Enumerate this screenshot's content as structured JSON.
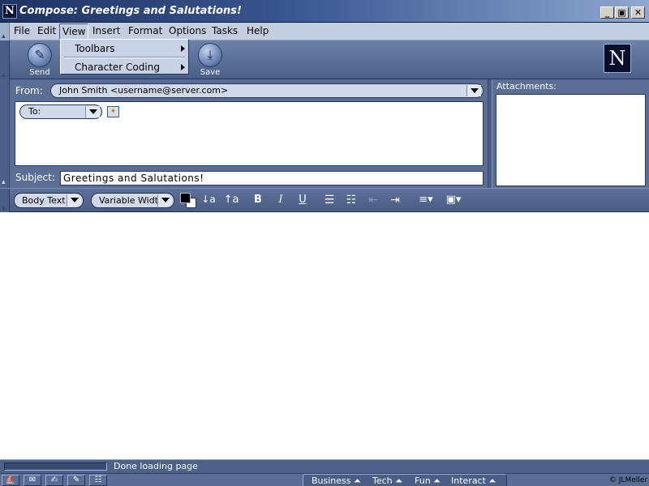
{
  "window": {
    "title": "Compose: Greetings and Salutations!",
    "app_icon": "N",
    "minimize_glyph": "_",
    "maximize_glyph": "▣",
    "close_glyph": "✕"
  },
  "menubar": {
    "items": [
      "File",
      "Edit",
      "View",
      "Insert",
      "Format",
      "Options",
      "Tasks",
      "Help"
    ],
    "active": "View"
  },
  "view_menu": {
    "items": [
      "Toolbars",
      "Character Coding"
    ]
  },
  "toolbar": {
    "send_label": "Send",
    "save_label": "Save",
    "logo": "N"
  },
  "compose": {
    "from_label": "From:",
    "from_value": "John Smith <username@server.com>",
    "to_label": "To:",
    "subject_label": "Subject:",
    "subject_value": "Greetings and Salutations!",
    "attachments_label": "Attachments:"
  },
  "format_toolbar": {
    "paragraph_style": "Body Text",
    "font": "Variable Width",
    "text_color": "#000000",
    "background_color": "#ffffff",
    "decrease_font_glyph": "↓a",
    "increase_font_glyph": "↑a",
    "bold_glyph": "B",
    "italic_glyph": "I",
    "underline_glyph": "U",
    "bullet_list_glyph": "☰",
    "numbered_list_glyph": "☷",
    "outdent_glyph": "⇤",
    "indent_glyph": "⇥",
    "align_glyph": "≡▾",
    "insert_glyph": "▣▾"
  },
  "status": {
    "text": "Done loading page",
    "progress": 0
  },
  "taskbar": {
    "icons": [
      "navigator-icon",
      "mail-icon",
      "composer-icon",
      "news-icon",
      "calendar-icon"
    ],
    "icon_glyphs": [
      "⛵",
      "✉",
      "✍",
      "✎",
      "☷"
    ],
    "quick_links": [
      "Business",
      "Tech",
      "Fun",
      "Interact"
    ],
    "copyright": "© JLMeller"
  },
  "colors": {
    "title_gradient_start": "#1e3262",
    "toolbar": "#5b6f95",
    "menubar": "#c3cfe0",
    "editor_bg": "#ffffff"
  }
}
